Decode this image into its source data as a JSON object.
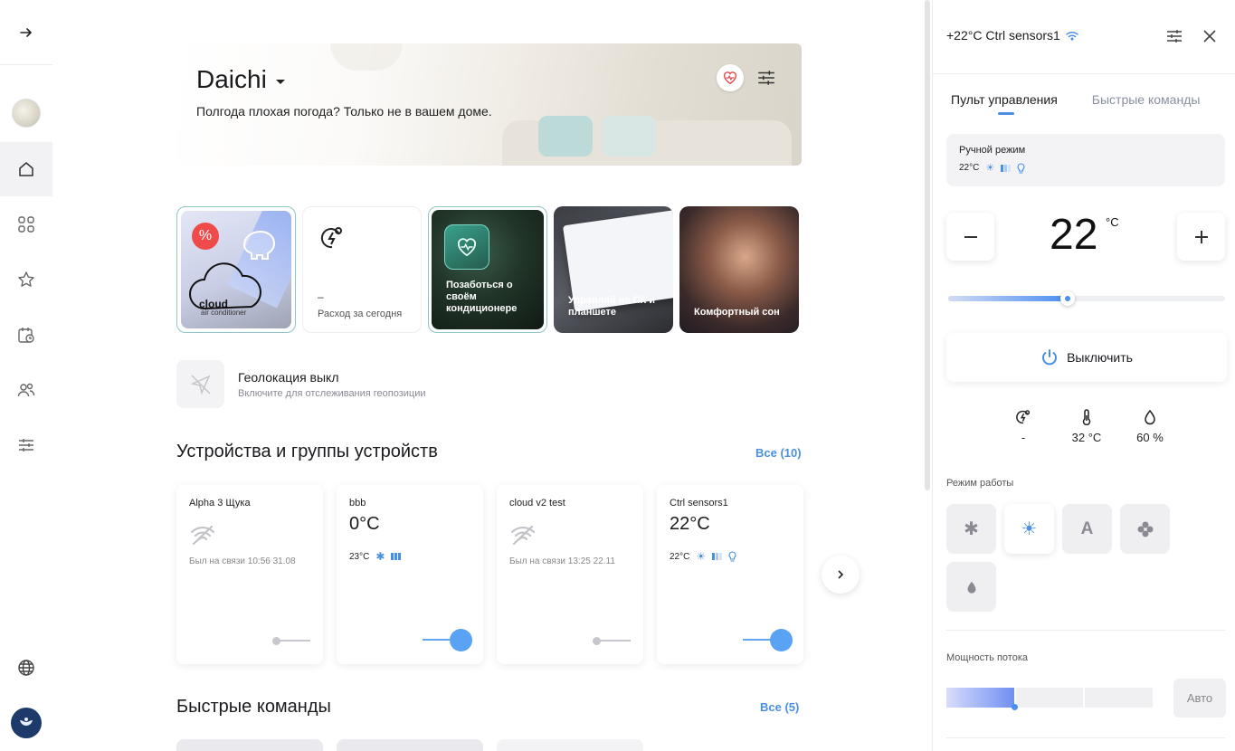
{
  "colors": {
    "accent": "#4a90e2",
    "danger": "#ef4b4b",
    "toggle_on": "#5aa2f3"
  },
  "sidebar": {
    "items": [
      {
        "name": "collapse-arrow-icon"
      },
      {
        "name": "profile-avatar"
      },
      {
        "name": "home-icon",
        "active": true
      },
      {
        "name": "grid-icon"
      },
      {
        "name": "star-icon"
      },
      {
        "name": "calendar-clock-icon"
      },
      {
        "name": "users-icon"
      },
      {
        "name": "sliders-icon"
      },
      {
        "name": "globe-icon"
      },
      {
        "name": "emblem-avatar"
      }
    ]
  },
  "hero": {
    "title": "Daichi",
    "subtitle": "Полгода плохая погода? Только не в вашем доме."
  },
  "tiles": {
    "cloud": {
      "badge": "%",
      "title": "cloud",
      "subtitle": "air conditioner"
    },
    "energy": {
      "value": "–",
      "label": "Расход за сегодня"
    },
    "care": {
      "caption": "Позаботься о своём кондиционере"
    },
    "pc": {
      "caption": "Управляй на ПК и планшете"
    },
    "sleep": {
      "caption": "Комфортный сон"
    }
  },
  "geo": {
    "title": "Геолокация выкл",
    "subtitle": "Включите для отслеживания геопозиции"
  },
  "devices_section": {
    "title": "Устройства и группы устройств",
    "link": "Все (10)"
  },
  "devices": [
    {
      "name": "Alpha 3 Щука",
      "status": "Был на связи 10:56 31.08",
      "online": false
    },
    {
      "name": "bbb",
      "temp": "0°C",
      "set_temp": "23°C",
      "online": true,
      "mode": "cool"
    },
    {
      "name": "cloud v2 test",
      "status": "Был на связи 13:25 22.11",
      "online": false
    },
    {
      "name": "Ctrl sensors1",
      "temp": "22°C",
      "set_temp": "22°C",
      "online": true,
      "mode": "heat"
    }
  ],
  "commands_section": {
    "title": "Быстрые команды",
    "link": "Все (5)"
  },
  "panel": {
    "title": "+22°C Ctrl sensors1",
    "tabs": [
      "Пульт управления",
      "Быстрые команды"
    ],
    "mode_card": {
      "title": "Ручной режим",
      "temp": "22°C"
    },
    "target_temp": "22",
    "unit": "°C",
    "slider_fraction": 0.43,
    "power_label": "Выключить",
    "stats": {
      "energy": "-",
      "temperature": "32 °C",
      "humidity": "60 %"
    },
    "mode_label": "Режим работы",
    "modes": [
      {
        "name": "cool-mode",
        "glyph": "✱"
      },
      {
        "name": "heat-mode",
        "glyph": "☀",
        "active": true
      },
      {
        "name": "auto-mode",
        "glyph": "A"
      },
      {
        "name": "fan-mode",
        "glyph": "✿"
      },
      {
        "name": "dry-mode",
        "glyph": "💧"
      }
    ],
    "flow_label": "Мощность потока",
    "flow_fraction": 0.33,
    "auto_label": "Авто"
  }
}
